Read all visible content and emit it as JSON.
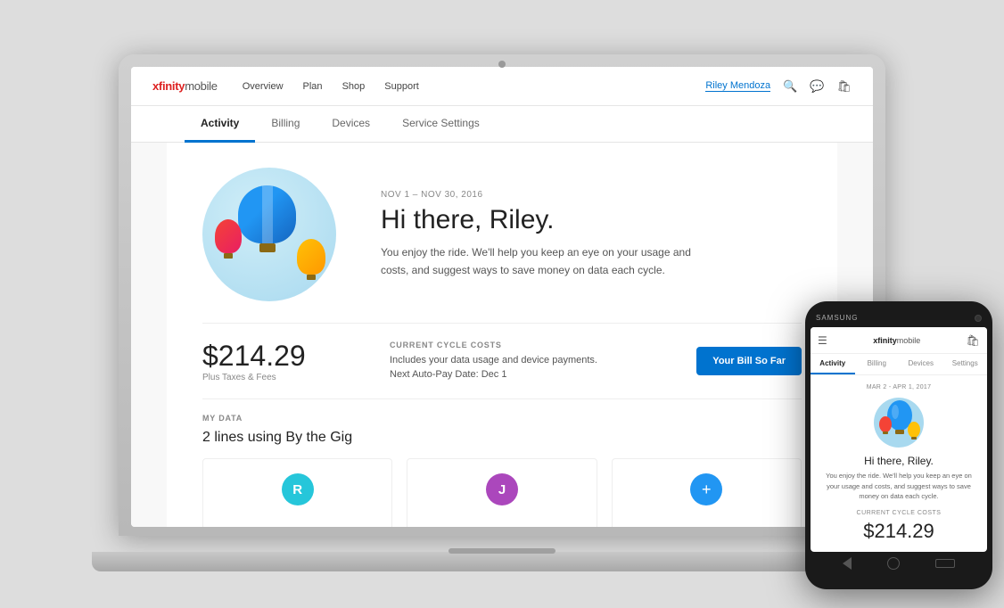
{
  "laptop": {
    "nav": {
      "logo": "xfinitymobile",
      "links": [
        "Overview",
        "Plan",
        "Shop",
        "Support"
      ],
      "user": "Riley Mendoza"
    },
    "tabs": [
      {
        "label": "Activity",
        "active": true
      },
      {
        "label": "Billing",
        "active": false
      },
      {
        "label": "Devices",
        "active": false
      },
      {
        "label": "Service Settings",
        "active": false
      }
    ],
    "hero": {
      "date": "NOV 1 – NOV 30, 2016",
      "title": "Hi there, Riley.",
      "body": "You enjoy the ride. We'll help you keep an eye on your usage and costs, and suggest ways to save money on data each cycle."
    },
    "billing": {
      "amount": "$214.29",
      "plus_taxes": "Plus Taxes & Fees",
      "section_title": "CURRENT CYCLE COSTS",
      "line1": "Includes your data usage and device payments.",
      "line2": "Next Auto-Pay Date: Dec 1",
      "button": "Your Bill So Far"
    },
    "my_data": {
      "label": "MY DATA",
      "subtitle": "2 lines using By the Gig",
      "users": [
        {
          "initial": "R",
          "color": "avatar-r"
        },
        {
          "initial": "J",
          "color": "avatar-j"
        }
      ]
    }
  },
  "phone": {
    "brand": "SAMSUNG",
    "nav": {
      "logo": "xfinitymobile"
    },
    "tabs": [
      {
        "label": "Activity",
        "active": true
      },
      {
        "label": "Billing",
        "active": false
      },
      {
        "label": "Devices",
        "active": false
      },
      {
        "label": "Settings",
        "active": false
      }
    ],
    "hero": {
      "date": "MAR 2 - APR 1, 2017",
      "title": "Hi there, Riley.",
      "body": "You enjoy the ride. We'll help you keep an eye on your usage and costs, and suggest ways to save money on data each cycle."
    },
    "billing": {
      "title": "CURRENT CYCLE COSTS",
      "amount": "$214.29"
    }
  }
}
